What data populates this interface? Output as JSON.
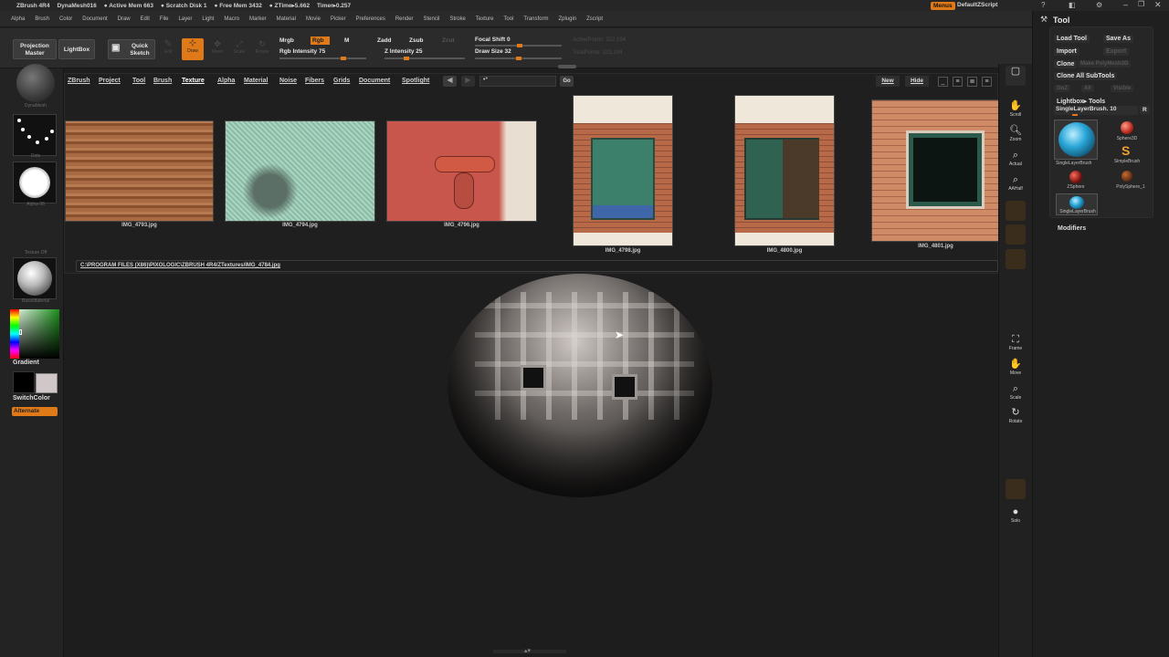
{
  "title_bar": {
    "status": [
      "ZBrush 4R4",
      "DynaMesh016",
      "● Active Mem 663",
      "● Scratch Disk 1",
      "● Free Mem 3432",
      "● ZTime▸5.662",
      "Timer▸0.257"
    ],
    "menus_button": "Menus",
    "script_name": "DefaultZScript"
  },
  "menubar": {
    "items": [
      "Alpha",
      "Brush",
      "Color",
      "Document",
      "Draw",
      "Edit",
      "File",
      "Layer",
      "Light",
      "Macro",
      "Marker",
      "Material",
      "Movie",
      "Picker",
      "Preferences",
      "Render",
      "Stencil",
      "Stroke",
      "Texture",
      "Tool",
      "Transform",
      "Zplugin",
      "Zscript"
    ]
  },
  "top_shelf": {
    "projection_master": "Projection Master",
    "lightbox": "LightBox",
    "quick_sketch": "Quick Sketch",
    "edit": "Edit",
    "draw": "Draw",
    "move": "Move",
    "scale": "Scale",
    "rotate": "Rotate",
    "mrgb": "Mrgb",
    "rgb": "Rgb",
    "m": "M",
    "rgb_intensity": "Rgb Intensity 75",
    "zadd": "Zadd",
    "zsub": "Zsub",
    "zcut": "Zcut",
    "z_intensity": "Z Intensity 25",
    "focal_shift": "Focal Shift 0",
    "draw_size": "Draw Size 32",
    "active_points": "ActivePoints: 322,194",
    "total_points": "TotalPoints: 322,194",
    "rgb_intensity_value": 75,
    "z_intensity_value": 25,
    "draw_size_value": 32
  },
  "left_shelf": {
    "brush_label": "DynaMesh",
    "stroke_label": "Dots",
    "alpha_label": "Alpha 06",
    "texture_label": "Texture Off",
    "material_label": "BasicMaterial",
    "gradient": "Gradient",
    "switchcolor": "SwitchColor",
    "alternate": "Alternate"
  },
  "texture_panel": {
    "nav": [
      "ZBrush",
      "Project",
      "Tool",
      "Brush",
      "Texture",
      "Alpha",
      "Material",
      "Noise",
      "Fibers",
      "Grids",
      "Document",
      "Spotlight"
    ],
    "search_text": "•*",
    "go": "Go",
    "new": "New",
    "hide": "Hide",
    "path": "C:\\PROGRAM FILES (X86)\\PIXOLOGIC\\ZBRUSH 4R4/ZTextures/IMG_4784.jpg",
    "items": [
      {
        "name": "IMG_4793.jpg",
        "color": "#9b5a35"
      },
      {
        "name": "IMG_4794.jpg",
        "color": "#9fc9b4"
      },
      {
        "name": "IMG_4796.jpg",
        "color": "#c4584f"
      },
      {
        "name": "IMG_4798.jpg",
        "color": "#2f6f5c"
      },
      {
        "name": "IMG_4800.jpg",
        "color": "#2e5c4c"
      },
      {
        "name": "IMG_4801.jpg",
        "color": "#c77f5a"
      }
    ]
  },
  "right_shelf": {
    "buttons": [
      "Scroll",
      "Zoom",
      "Actual",
      "AAHalf",
      "Frame",
      "Move",
      "Scale",
      "Rotate",
      "Solo"
    ]
  },
  "tool_panel": {
    "title": "Tool",
    "load_tool": "Load Tool",
    "save_as": "Save As",
    "import": "Import",
    "export": "Export",
    "clone": "Clone",
    "make_polymesh": "Make PolyMesh3D",
    "clone_all": "Clone All SubTools",
    "goz": "GoZ",
    "all": "All",
    "visible": "Visible",
    "lightbox_tools": "Lightbox▸ Tools",
    "current_tool": "SingleLayerBrush. 10",
    "r": "R",
    "tools": [
      "SingleLayerBrush",
      "Sphere3D",
      "SimpleBrush",
      "ZSphere",
      "PolySphere_1",
      "SingleLayerBrush"
    ],
    "modifiers": "Modifiers"
  }
}
